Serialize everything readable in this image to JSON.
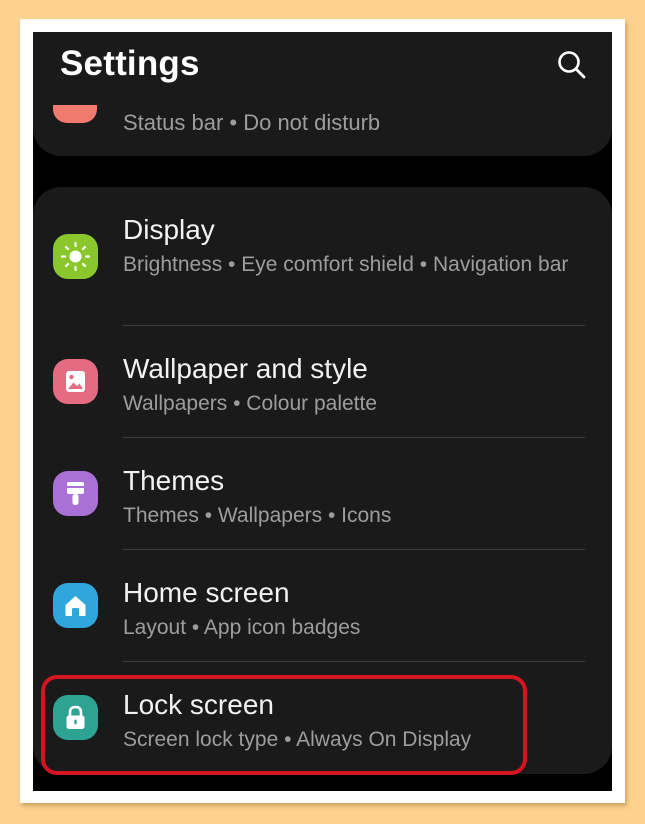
{
  "header": {
    "title": "Settings",
    "search_icon": "search-icon"
  },
  "partial_item": {
    "subtitle": "Status bar • Do not disturb",
    "icon_color": "#f07a6e"
  },
  "items": [
    {
      "title": "Display",
      "subtitle": "Brightness • Eye comfort shield • Navigation bar",
      "icon": "sun-icon",
      "icon_color": "#8ac72c"
    },
    {
      "title": "Wallpaper and style",
      "subtitle": "Wallpapers • Colour palette",
      "icon": "image-icon",
      "icon_color": "#e36c82"
    },
    {
      "title": "Themes",
      "subtitle": "Themes • Wallpapers • Icons",
      "icon": "brush-icon",
      "icon_color": "#a971d6"
    },
    {
      "title": "Home screen",
      "subtitle": "Layout • App icon badges",
      "icon": "home-icon",
      "icon_color": "#2fa7dd"
    },
    {
      "title": "Lock screen",
      "subtitle": "Screen lock type • Always On Display",
      "icon": "lock-icon",
      "icon_color": "#2ea394"
    }
  ],
  "highlight_color": "#d41420",
  "highlighted_item": "Lock screen"
}
